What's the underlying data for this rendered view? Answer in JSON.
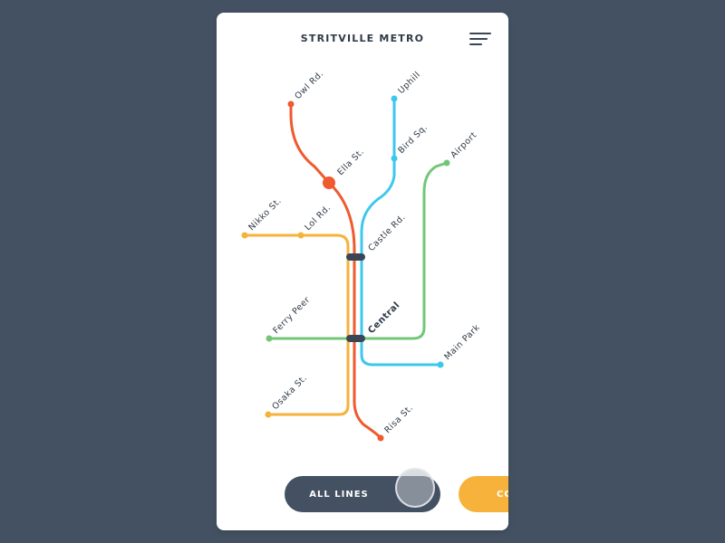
{
  "app": {
    "title": "STRITVILLE METRO"
  },
  "colors": {
    "background": "#435162",
    "red_line": "#ef5a2f",
    "blue_line": "#3cc8ee",
    "green_line": "#72c777",
    "yellow_line": "#f6b23a",
    "interchange": "#3a4655"
  },
  "icons": {
    "menu": "hamburger-menu-icon"
  },
  "stations": {
    "owl_rd": "Owl Rd.",
    "ella_st": "Ella St.",
    "uphill": "Uphill",
    "bird_sq": "Bird Sq.",
    "airport": "Airport",
    "nikko_st": "Nikko St.",
    "lol_rd": "Lol Rd.",
    "castle_rd": "Castle Rd.",
    "ferry_peer": "Ferry Peer",
    "central": "Central",
    "main_park": "Main Park",
    "osaka_st": "Osaka St.",
    "risa_st": "Risa St."
  },
  "buttons": {
    "all_lines": "ALL LINES",
    "second": "CO"
  }
}
